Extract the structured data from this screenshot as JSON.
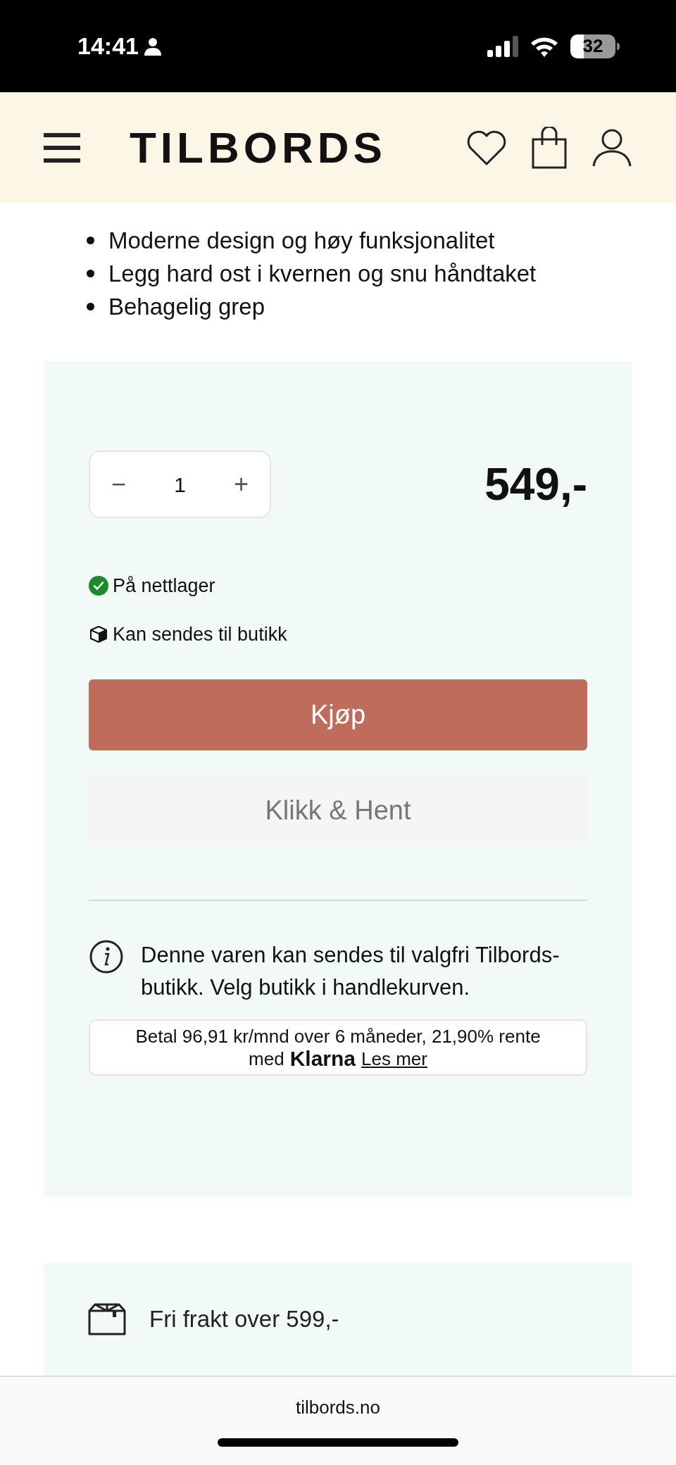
{
  "status_bar": {
    "time": "14:41",
    "battery": "32"
  },
  "header": {
    "logo": "TILBORDS"
  },
  "features": [
    "Moderne design og høy funksjonalitet",
    "Legg hard ost i kvernen og snu håndtaket",
    "Behagelig grep"
  ],
  "purchase": {
    "quantity": {
      "decrease": "−",
      "value": "1",
      "increase": "+"
    },
    "price": "549,-",
    "availability": [
      {
        "kind": "check",
        "text": "På nettlager"
      },
      {
        "kind": "package",
        "text": "Kan sendes til butikk"
      }
    ],
    "buy_button": "Kjøp",
    "pickup_button": {
      "label": "Klikk & Hent",
      "disabled": true
    },
    "info": "Denne varen kan sendes til valgfri Tilbords-butikk. Velg butikk i handlekurven.",
    "klarna": {
      "text": "Betal 96,91 kr/mnd over 6 måneder, 21,90% rente",
      "connector": "med",
      "brand": "Klarna",
      "link": "Les mer"
    }
  },
  "shipping": {
    "text": "Fri frakt over 599,-"
  },
  "browser": {
    "url": "tilbords.no"
  }
}
